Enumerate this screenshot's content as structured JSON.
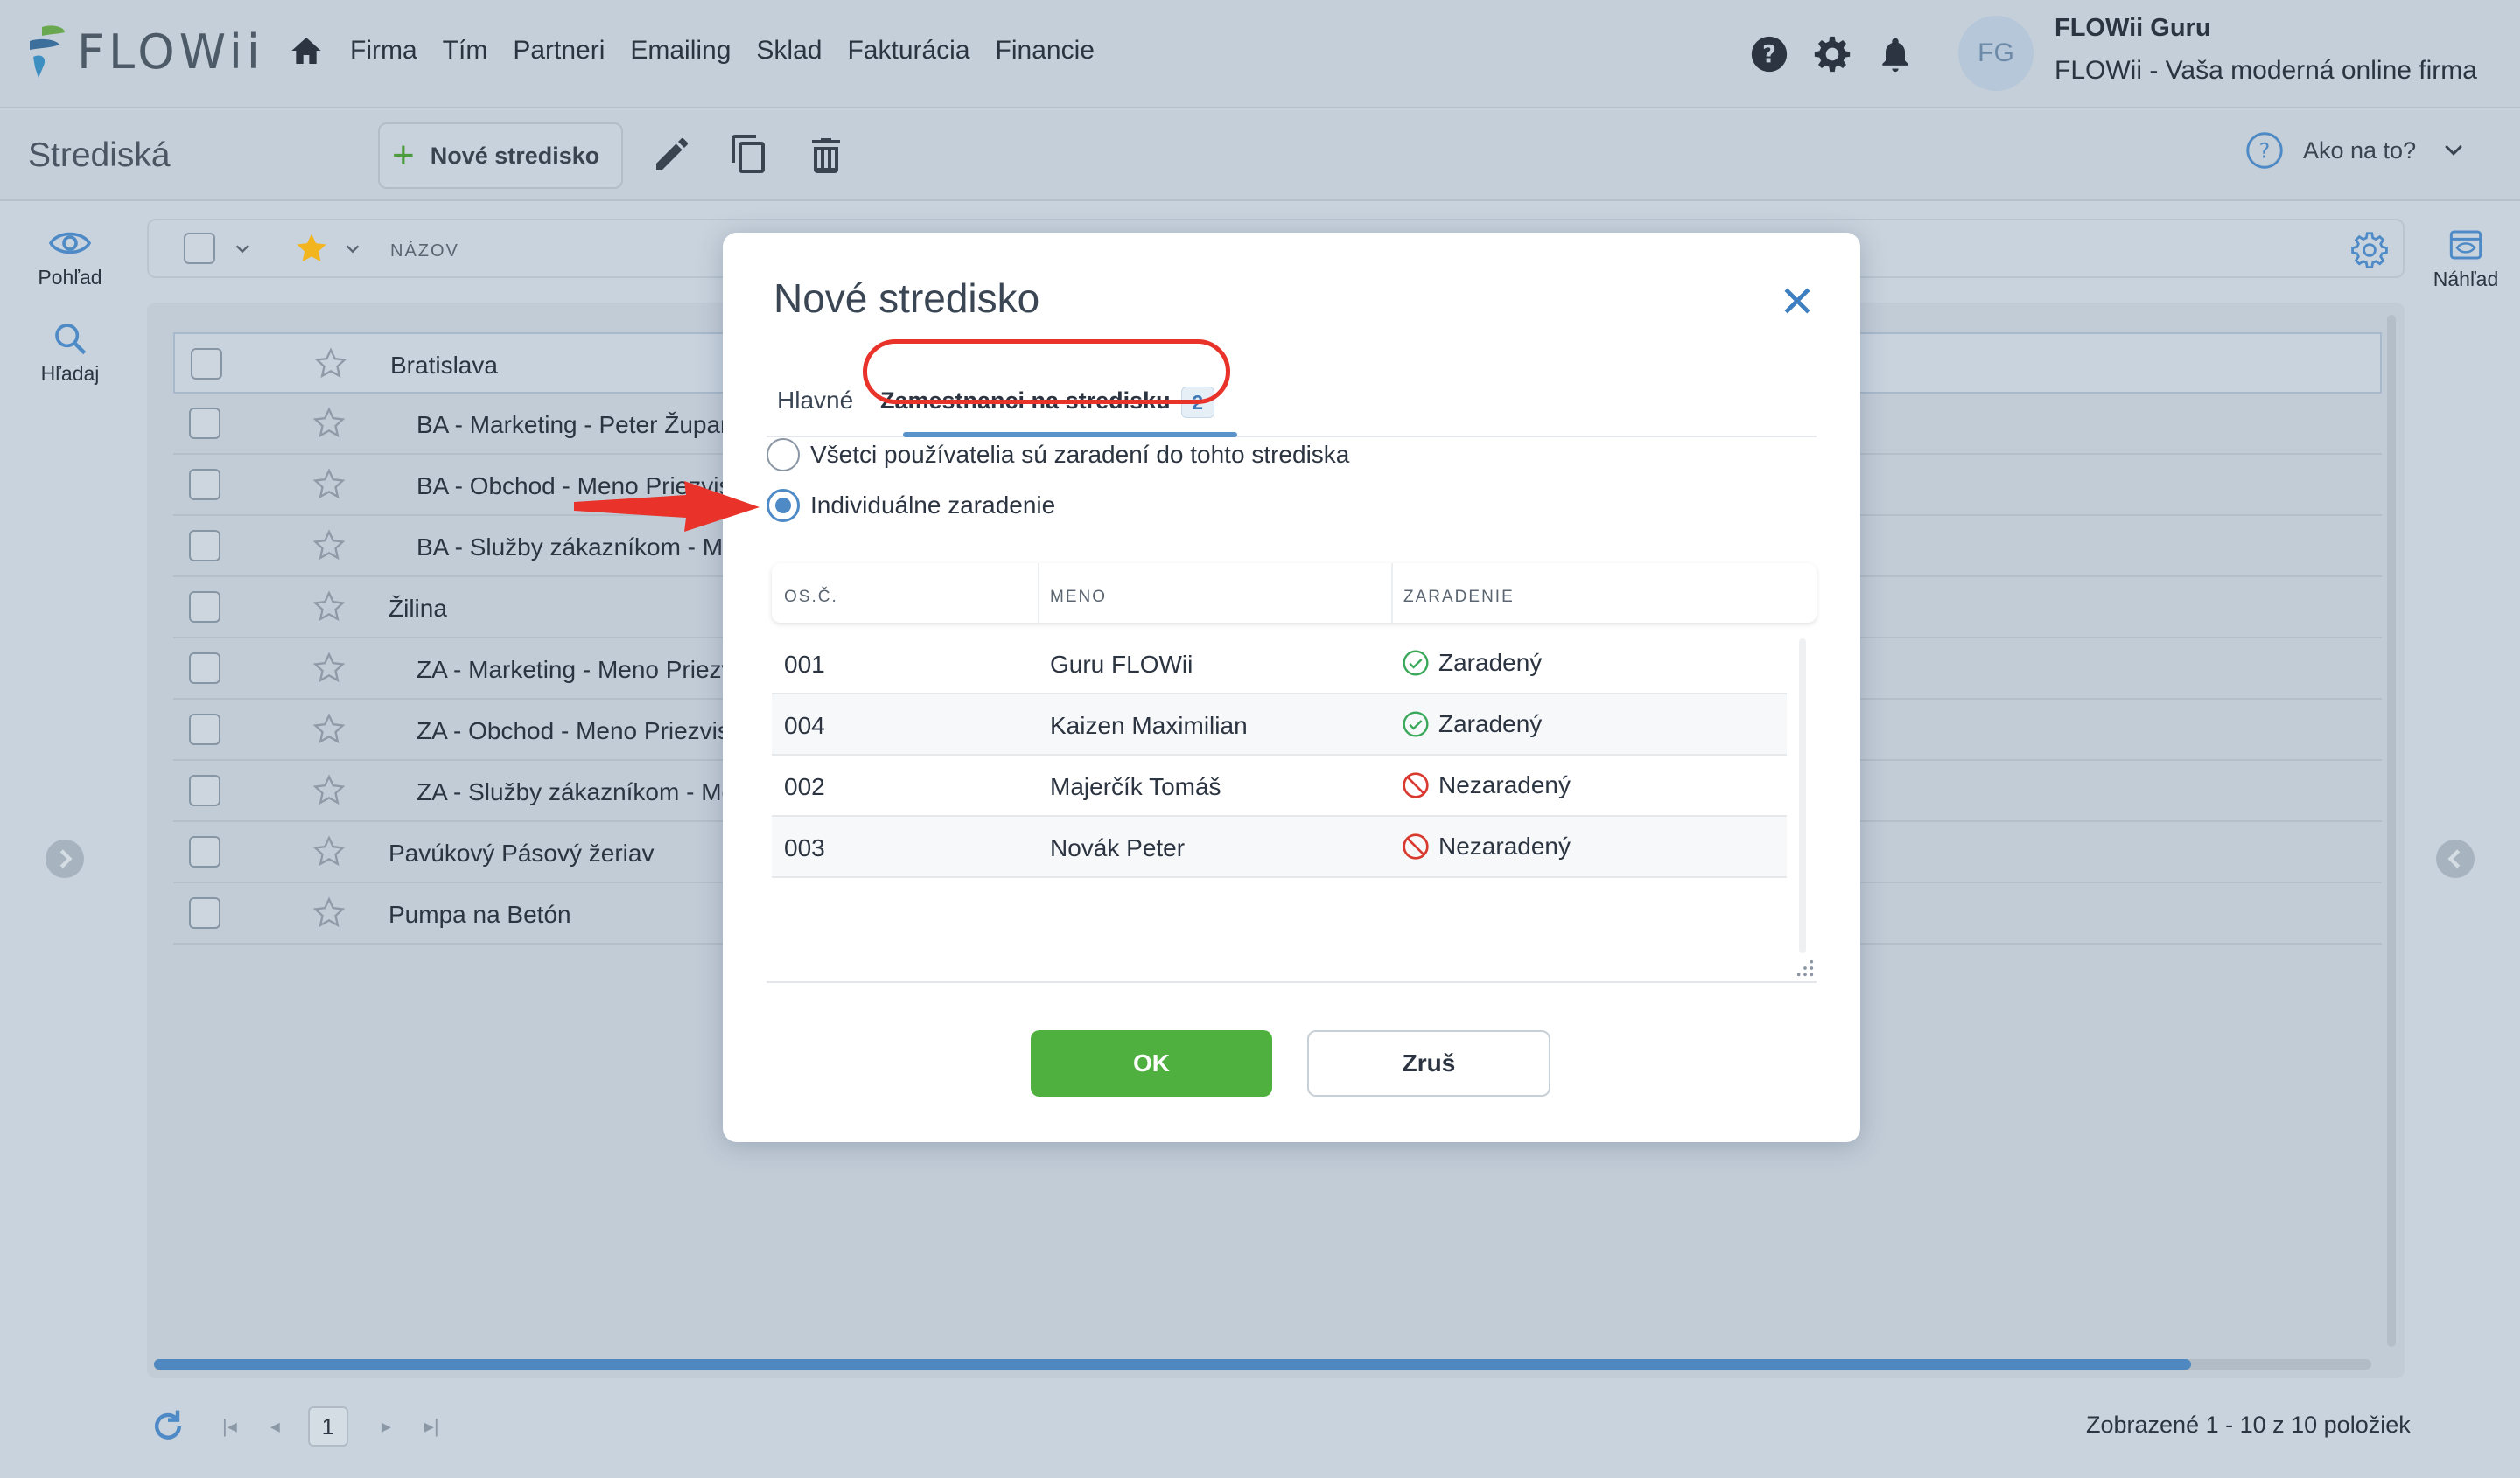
{
  "app": {
    "brand": "FLOWii",
    "nav": [
      "Firma",
      "Tím",
      "Partneri",
      "Emailing",
      "Sklad",
      "Fakturácia",
      "Financie"
    ],
    "user": {
      "initials": "FG",
      "name": "FLOWii Guru",
      "company": "FLOWii - Vaša moderná online firma"
    }
  },
  "toolbar": {
    "title": "Strediská",
    "new_button": "Nové stredisko",
    "help": "Ako na to?"
  },
  "rail": {
    "view": "Pohľad",
    "search": "Hľadaj",
    "preview": "Náhľad"
  },
  "list": {
    "column_name": "NÁZOV",
    "rows": [
      {
        "name": "Bratislava",
        "child": false
      },
      {
        "name": "BA - Marketing - Peter Županl",
        "child": true
      },
      {
        "name": "BA - Obchod - Meno Priezvis",
        "child": true
      },
      {
        "name": "BA - Služby zákazníkom - Me",
        "child": true
      },
      {
        "name": "Žilina",
        "child": false
      },
      {
        "name": "ZA - Marketing - Meno Priezv",
        "child": true
      },
      {
        "name": "ZA - Obchod - Meno Priezvis",
        "child": true
      },
      {
        "name": "ZA - Služby zákazníkom - Me",
        "child": true
      },
      {
        "name": "Pavúkový Pásový žeriav",
        "child": false
      },
      {
        "name": "Pumpa na Betón",
        "child": false
      }
    ]
  },
  "pager": {
    "current_page": "1",
    "info": "Zobrazené 1 - 10 z 10 položiek"
  },
  "modal": {
    "title": "Nové stredisko",
    "tabs": {
      "main": "Hlavné",
      "employees": "Zamestnanci na stredisku",
      "employees_count": "2"
    },
    "options": {
      "all": "Všetci používatelia sú zaradení do tohto strediska",
      "individual": "Individuálne zaradenie",
      "selected": "individual"
    },
    "grid": {
      "columns": [
        "OS.Č.",
        "MENO",
        "ZARADENIE"
      ],
      "rows": [
        {
          "id": "001",
          "name": "Guru FLOWii",
          "status": "Zaradený",
          "assigned": true
        },
        {
          "id": "004",
          "name": "Kaizen Maximilian",
          "status": "Zaradený",
          "assigned": true
        },
        {
          "id": "002",
          "name": "Majerčík Tomáš",
          "status": "Nezaradený",
          "assigned": false
        },
        {
          "id": "003",
          "name": "Novák Peter",
          "status": "Nezaradený",
          "assigned": false
        }
      ]
    },
    "ok": "OK",
    "cancel": "Zruš"
  },
  "colors": {
    "accent": "#4d8ac6",
    "ok_green": "#4fb03f",
    "assigned": "#3aa85a",
    "unassigned": "#d93a2f",
    "highlight": "#e8322a"
  }
}
